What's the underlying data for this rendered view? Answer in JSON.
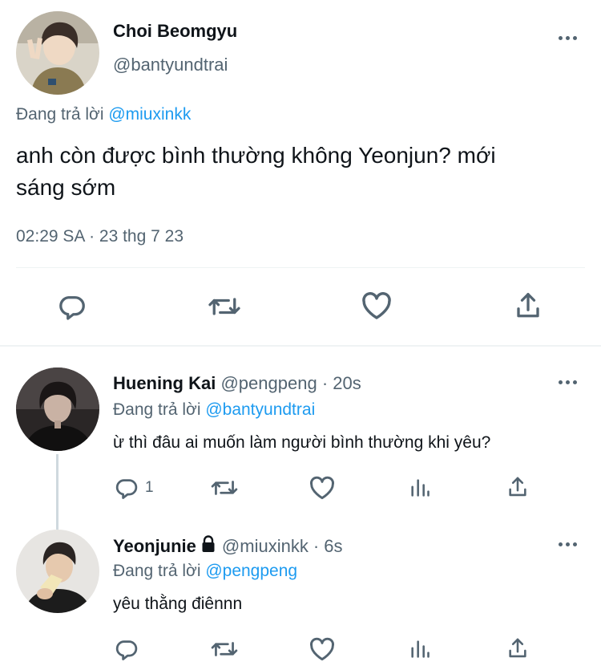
{
  "main_tweet": {
    "author_name": "Choi Beomgyu",
    "author_handle": "@bantyundtrai",
    "reply_prefix": "Đang trả lời",
    "reply_to": "@miuxinkk",
    "text_line1": "anh còn được bình thường không Yeonjun? mới",
    "text_line2": "sáng sớm",
    "timestamp": "02:29 SA · 23 thg 7 23",
    "actions": [
      "reply-icon",
      "retweet-icon",
      "like-icon",
      "share-icon"
    ]
  },
  "replies": [
    {
      "author_name": "Huening Kai",
      "author_handle": "@pengpeng",
      "time": "· 20s",
      "reply_prefix": "Đang trả lời",
      "reply_to": "@bantyundtrai",
      "text": "ừ thì đâu ai muốn làm người bình thường khi yêu?",
      "reply_count": "1",
      "actions": [
        "reply-icon",
        "retweet-icon",
        "like-icon",
        "analytics-icon",
        "share-icon"
      ]
    },
    {
      "author_name": "Yeonjunie",
      "author_handle": "@miuxinkk",
      "time": "· 6s",
      "locked": true,
      "reply_prefix": "Đang trả lời",
      "reply_to": "@pengpeng",
      "text": "yêu thằng điênnn",
      "reply_count": "",
      "actions": [
        "reply-icon",
        "retweet-icon",
        "like-icon",
        "analytics-icon",
        "share-icon"
      ]
    }
  ],
  "colors": {
    "text": "#0f1419",
    "muted": "#536471",
    "link": "#1d9bf0",
    "divider": "#eff3f4"
  }
}
